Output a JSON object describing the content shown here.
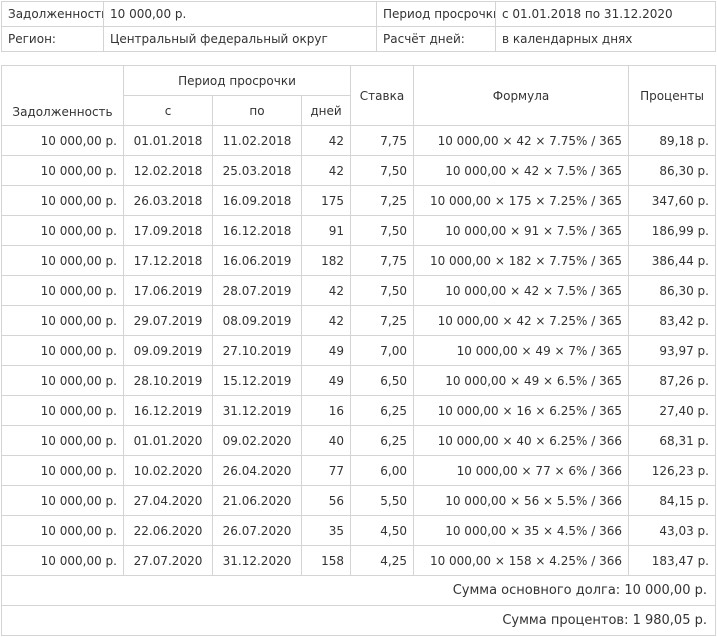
{
  "info": {
    "debt_label": "Задолженность:",
    "debt_value": "10 000,00 р.",
    "period_label": "Период просрочки:",
    "period_value": "с 01.01.2018 по 31.12.2020",
    "region_label": "Регион:",
    "region_value": "Центральный федеральный округ",
    "days_label": "Расчёт дней:",
    "days_value": "в календарных днях"
  },
  "table": {
    "headers": {
      "debt": "Задолженность",
      "period": "Период просрочки",
      "from": "с",
      "to": "по",
      "days": "дней",
      "rate": "Ставка",
      "formula": "Формула",
      "interest": "Проценты"
    },
    "rows": [
      {
        "debt": "10 000,00 р.",
        "from": "01.01.2018",
        "to": "11.02.2018",
        "days": "42",
        "rate": "7,75",
        "formula": "10 000,00 × 42 × 7.75% / 365",
        "interest": "89,18 р."
      },
      {
        "debt": "10 000,00 р.",
        "from": "12.02.2018",
        "to": "25.03.2018",
        "days": "42",
        "rate": "7,50",
        "formula": "10 000,00 × 42 × 7.5% / 365",
        "interest": "86,30 р."
      },
      {
        "debt": "10 000,00 р.",
        "from": "26.03.2018",
        "to": "16.09.2018",
        "days": "175",
        "rate": "7,25",
        "formula": "10 000,00 × 175 × 7.25% / 365",
        "interest": "347,60 р."
      },
      {
        "debt": "10 000,00 р.",
        "from": "17.09.2018",
        "to": "16.12.2018",
        "days": "91",
        "rate": "7,50",
        "formula": "10 000,00 × 91 × 7.5% / 365",
        "interest": "186,99 р."
      },
      {
        "debt": "10 000,00 р.",
        "from": "17.12.2018",
        "to": "16.06.2019",
        "days": "182",
        "rate": "7,75",
        "formula": "10 000,00 × 182 × 7.75% / 365",
        "interest": "386,44 р."
      },
      {
        "debt": "10 000,00 р.",
        "from": "17.06.2019",
        "to": "28.07.2019",
        "days": "42",
        "rate": "7,50",
        "formula": "10 000,00 × 42 × 7.5% / 365",
        "interest": "86,30 р."
      },
      {
        "debt": "10 000,00 р.",
        "from": "29.07.2019",
        "to": "08.09.2019",
        "days": "42",
        "rate": "7,25",
        "formula": "10 000,00 × 42 × 7.25% / 365",
        "interest": "83,42 р."
      },
      {
        "debt": "10 000,00 р.",
        "from": "09.09.2019",
        "to": "27.10.2019",
        "days": "49",
        "rate": "7,00",
        "formula": "10 000,00 × 49 × 7% / 365",
        "interest": "93,97 р."
      },
      {
        "debt": "10 000,00 р.",
        "from": "28.10.2019",
        "to": "15.12.2019",
        "days": "49",
        "rate": "6,50",
        "formula": "10 000,00 × 49 × 6.5% / 365",
        "interest": "87,26 р."
      },
      {
        "debt": "10 000,00 р.",
        "from": "16.12.2019",
        "to": "31.12.2019",
        "days": "16",
        "rate": "6,25",
        "formula": "10 000,00 × 16 × 6.25% / 365",
        "interest": "27,40 р."
      },
      {
        "debt": "10 000,00 р.",
        "from": "01.01.2020",
        "to": "09.02.2020",
        "days": "40",
        "rate": "6,25",
        "formula": "10 000,00 × 40 × 6.25% / 366",
        "interest": "68,31 р."
      },
      {
        "debt": "10 000,00 р.",
        "from": "10.02.2020",
        "to": "26.04.2020",
        "days": "77",
        "rate": "6,00",
        "formula": "10 000,00 × 77 × 6% / 366",
        "interest": "126,23 р."
      },
      {
        "debt": "10 000,00 р.",
        "from": "27.04.2020",
        "to": "21.06.2020",
        "days": "56",
        "rate": "5,50",
        "formula": "10 000,00 × 56 × 5.5% / 366",
        "interest": "84,15 р."
      },
      {
        "debt": "10 000,00 р.",
        "from": "22.06.2020",
        "to": "26.07.2020",
        "days": "35",
        "rate": "4,50",
        "formula": "10 000,00 × 35 × 4.5% / 366",
        "interest": "43,03 р."
      },
      {
        "debt": "10 000,00 р.",
        "from": "27.07.2020",
        "to": "31.12.2020",
        "days": "158",
        "rate": "4,25",
        "formula": "10 000,00 × 158 × 4.25% / 366",
        "interest": "183,47 р."
      }
    ],
    "principal_total": "Сумма основного долга: 10 000,00 р.",
    "interest_total": "Сумма процентов: 1 980,05 р."
  }
}
